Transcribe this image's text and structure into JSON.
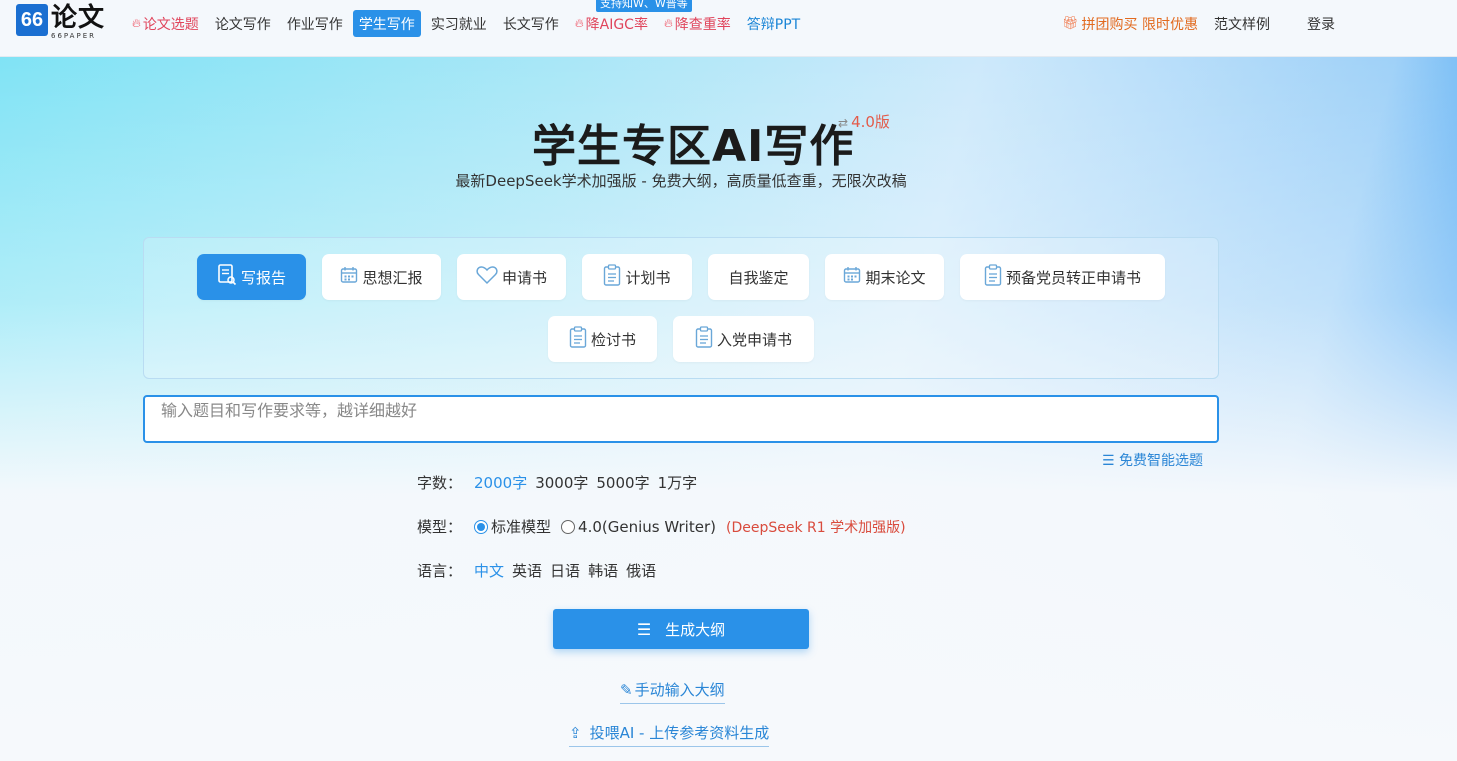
{
  "header": {
    "logo": {
      "mark": "66",
      "name": "论文",
      "sub": "66PAPER"
    },
    "nav": [
      {
        "label": "论文选题",
        "style": "hot",
        "icon": "flame-icon"
      },
      {
        "label": "论文写作",
        "style": "plain"
      },
      {
        "label": "作业写作",
        "style": "plain"
      },
      {
        "label": "学生写作",
        "style": "active"
      },
      {
        "label": "实习就业",
        "style": "plain"
      },
      {
        "label": "长文写作",
        "style": "plain"
      },
      {
        "label": "降AIGC率",
        "style": "hot",
        "icon": "flame-icon"
      },
      {
        "label": "降查重率",
        "style": "hot",
        "icon": "flame-icon"
      },
      {
        "label": "答辩PPT",
        "style": "blue"
      }
    ],
    "nav_badge": "支持知W、W普等",
    "promo": "拼团购买 限时优惠",
    "samples": "范文样例",
    "login": "登录"
  },
  "hero": {
    "title": "学生专区AI写作",
    "version": "4.0版",
    "subtitle": "最新DeepSeek学术加强版 - 免费大纲，高质量低查重，无限次改稿"
  },
  "categories": [
    {
      "label": "写报告",
      "icon": "report-icon",
      "active": true
    },
    {
      "label": "思想汇报",
      "icon": "calendar-icon",
      "active": false
    },
    {
      "label": "申请书",
      "icon": "heart-icon",
      "active": false
    },
    {
      "label": "计划书",
      "icon": "clipboard-icon",
      "active": false
    },
    {
      "label": "自我鉴定",
      "icon": "",
      "active": false
    },
    {
      "label": "期末论文",
      "icon": "calendar-icon",
      "active": false
    },
    {
      "label": "预备党员转正申请书",
      "icon": "clipboard-icon",
      "active": false
    },
    {
      "label": "检讨书",
      "icon": "clipboard-icon",
      "active": false
    },
    {
      "label": "入党申请书",
      "icon": "clipboard-icon",
      "active": false
    }
  ],
  "input": {
    "placeholder": "输入题目和写作要求等，越详细越好",
    "value": ""
  },
  "free_topic": "免费智能选题",
  "options": {
    "words": {
      "label": "字数：",
      "values": [
        "2000字",
        "3000字",
        "5000字",
        "1万字"
      ],
      "selected": "2000字"
    },
    "model": {
      "label": "模型：",
      "choices": [
        {
          "label": "标准模型",
          "checked": true
        },
        {
          "label": "4.0(Genius Writer)",
          "checked": false
        }
      ],
      "note": "(DeepSeek R1 学术加强版)"
    },
    "language": {
      "label": "语言：",
      "values": [
        "中文",
        "英语",
        "日语",
        "韩语",
        "俄语"
      ],
      "selected": "中文"
    }
  },
  "actions": {
    "generate": "生成大纲",
    "manual": "手动输入大纲",
    "upload": "投喂AI - 上传参考资料生成"
  },
  "colors": {
    "accent": "#2a91e8",
    "hot": "#e0455c",
    "note": "#d94b3d",
    "promo": "#e26a1f"
  }
}
